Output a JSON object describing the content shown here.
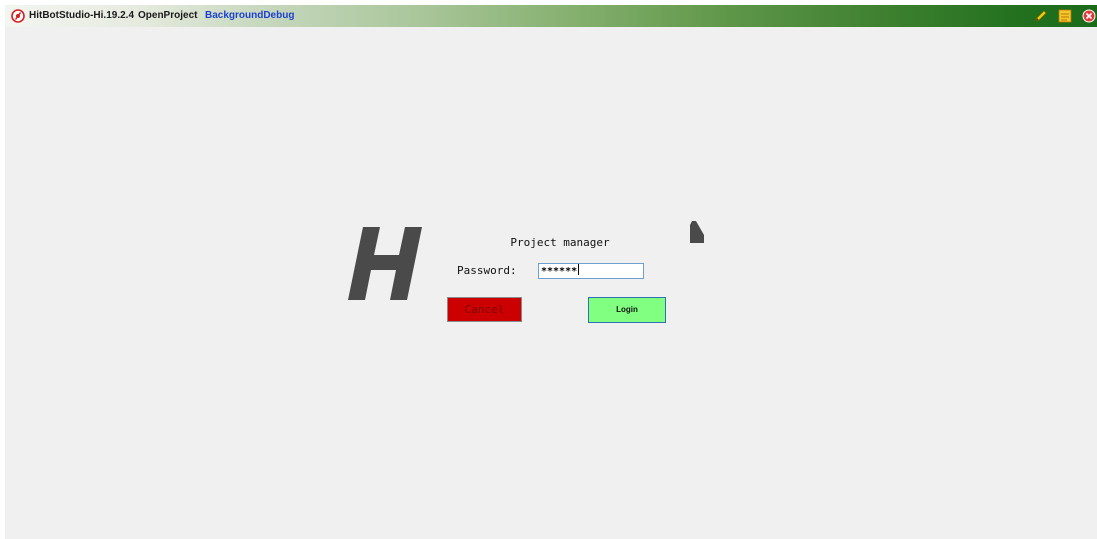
{
  "titlebar": {
    "app_title": "HitBotStudio-Hi.19.2.4",
    "menu": [
      {
        "label": "OpenProject"
      },
      {
        "label": "BackgroundDebug"
      }
    ],
    "icons": [
      "edit-pen-icon",
      "notes-icon",
      "close-icon"
    ],
    "gradient_colors": [
      "#f3f5f1",
      "#1a6a1a"
    ]
  },
  "login_dialog": {
    "title": "Project manager",
    "password_label": "Password:",
    "password_value": "******",
    "cancel_label": "Cancel",
    "login_label": "Login",
    "colors": {
      "cancel_bg": "#cc0000",
      "login_bg": "#80ff80"
    }
  }
}
